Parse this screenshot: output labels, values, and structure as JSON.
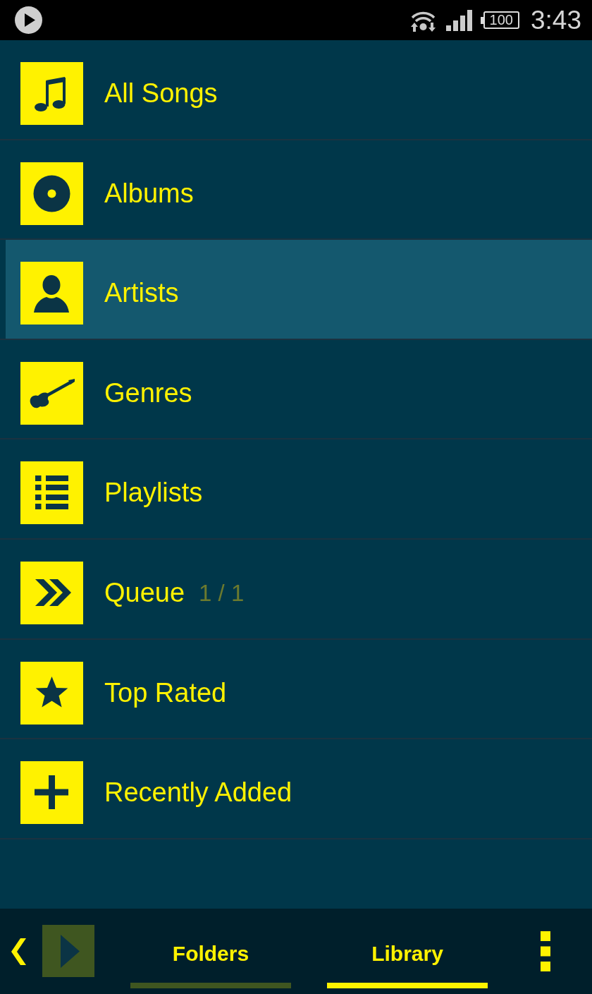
{
  "status_bar": {
    "battery": "100",
    "time": "3:43"
  },
  "menu": {
    "items": [
      {
        "label": "All Songs",
        "kind": "songs",
        "selected": false
      },
      {
        "label": "Albums",
        "kind": "albums",
        "selected": false
      },
      {
        "label": "Artists",
        "kind": "artists",
        "selected": true
      },
      {
        "label": "Genres",
        "kind": "genres",
        "selected": false
      },
      {
        "label": "Playlists",
        "kind": "playlists",
        "selected": false
      },
      {
        "label": "Queue",
        "kind": "queue",
        "count": "1 / 1",
        "selected": false
      },
      {
        "label": "Top Rated",
        "kind": "rated",
        "selected": false
      },
      {
        "label": "Recently Added",
        "kind": "recent",
        "selected": false
      }
    ]
  },
  "bottom_bar": {
    "tabs": [
      {
        "label": "Folders",
        "selected": false
      },
      {
        "label": "Library",
        "selected": true
      }
    ]
  }
}
